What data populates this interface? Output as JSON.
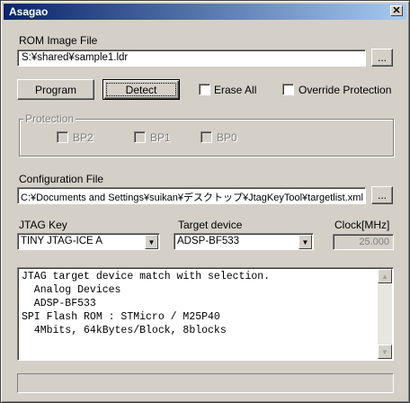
{
  "window": {
    "title": "Asagao",
    "close_glyph": "✕"
  },
  "rom": {
    "label": "ROM Image File",
    "path": "S:¥shared¥sample1.ldr",
    "browse_label": "..."
  },
  "actions": {
    "program_label": "Program",
    "detect_label": "Detect"
  },
  "options": {
    "erase_all_label": "Erase All",
    "override_label": "Override Protection",
    "erase_all_checked": false,
    "override_checked": false
  },
  "protection": {
    "title": "Protection",
    "bp2": "BP2",
    "bp1": "BP1",
    "bp0": "BP0"
  },
  "config": {
    "label": "Configuration File",
    "path": "C:¥Documents and Settings¥suikan¥デスクトップ¥JtagKeyTool¥targetlist.xml",
    "browse_label": "..."
  },
  "jtag": {
    "label": "JTAG Key",
    "selected": "TINY JTAG-ICE A"
  },
  "target": {
    "label": "Target device",
    "selected": "ADSP-BF533"
  },
  "clock": {
    "label": "Clock[MHz]",
    "value": "25.000"
  },
  "output": {
    "text": "JTAG target device match with selection.\n  Analog Devices\n  ADSP-BF533\nSPI Flash ROM : STMicro / M25P40\n  4Mbits, 64kBytes/Block, 8blocks"
  },
  "icons": {
    "dropdown_arrow": "▼",
    "scroll_up": "▲",
    "scroll_down": "▼"
  },
  "colors": {
    "titlebar_start": "#0a246a",
    "titlebar_end": "#a6caf0",
    "face": "#d4d0c8"
  }
}
